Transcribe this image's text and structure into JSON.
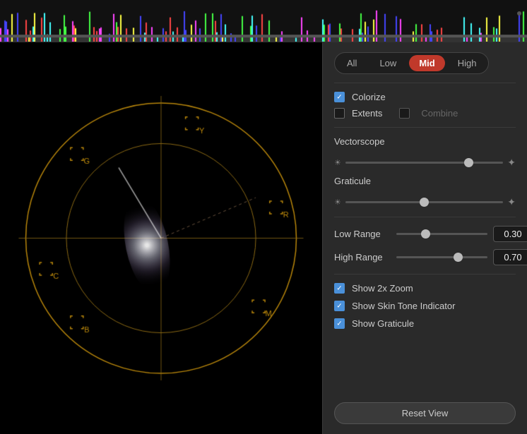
{
  "topbar": {
    "description": "Waveform histogram display"
  },
  "tabs": {
    "items": [
      "All",
      "Low",
      "Mid",
      "High"
    ],
    "active": "Mid"
  },
  "controls": {
    "colorize_label": "Colorize",
    "colorize_checked": true,
    "extents_label": "Extents",
    "extents_checked": false,
    "combine_label": "Combine",
    "combine_checked": false,
    "vectorscope_label": "Vectorscope",
    "graticule_label": "Graticule",
    "vectorscope_value": 80,
    "graticule_value": 50,
    "low_range_label": "Low Range",
    "low_range_value": "0.30",
    "low_range_slider": 30,
    "high_range_label": "High Range",
    "high_range_value": "0.70",
    "high_range_slider": 70,
    "show_2x_zoom_label": "Show 2x Zoom",
    "show_2x_zoom_checked": true,
    "show_skin_tone_label": "Show Skin Tone Indicator",
    "show_skin_tone_checked": true,
    "show_graticule_label": "Show Graticule",
    "show_graticule_checked": true,
    "reset_label": "Reset View"
  },
  "icons": {
    "sun_dim": "☀",
    "sun_bright": "✦",
    "check": "✓"
  }
}
